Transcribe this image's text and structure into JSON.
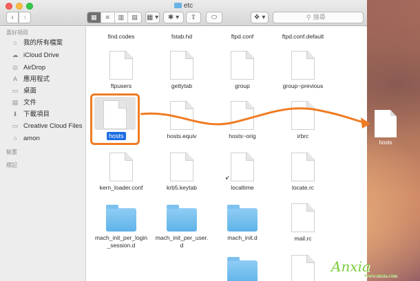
{
  "window": {
    "title": "etc"
  },
  "toolbar": {
    "back": "‹",
    "forward": "›",
    "view_icons": [
      "▦",
      "≡",
      "▥",
      "▤"
    ],
    "arrange": "▦ ▾",
    "action": "✱ ▾",
    "share": "⇪",
    "tag": "⬭",
    "dropbox": "❖ ▾",
    "search_placeholder": "搜尋",
    "search_icon": "⚲"
  },
  "sidebar": {
    "favorites_header": "喜好項目",
    "items": [
      {
        "icon": "⌂",
        "label": "我的所有檔案"
      },
      {
        "icon": "☁",
        "label": "iCloud Drive"
      },
      {
        "icon": "◎",
        "label": "AirDrop"
      },
      {
        "icon": "A",
        "label": "應用程式"
      },
      {
        "icon": "▭",
        "label": "桌面"
      },
      {
        "icon": "▤",
        "label": "文件"
      },
      {
        "icon": "⬇",
        "label": "下載項目"
      },
      {
        "icon": "▭",
        "label": "Creative Cloud Files"
      },
      {
        "icon": "⌂",
        "label": "amon"
      }
    ],
    "devices_header": "裝置",
    "tags_header": "標記"
  },
  "files": [
    {
      "name": "find.codes",
      "kind": "doc-partial"
    },
    {
      "name": "fstab.hd",
      "kind": "doc-partial"
    },
    {
      "name": "ftpd.conf",
      "kind": "doc-partial"
    },
    {
      "name": "ftpd.conf.default",
      "kind": "doc-partial"
    },
    {
      "name": "ftpusers",
      "kind": "doc"
    },
    {
      "name": "gettytab",
      "kind": "doc"
    },
    {
      "name": "group",
      "kind": "doc"
    },
    {
      "name": "group~previous",
      "kind": "doc"
    },
    {
      "name": "hosts",
      "kind": "selected"
    },
    {
      "name": "hosts.equiv",
      "kind": "doc"
    },
    {
      "name": "hosts~orig",
      "kind": "doc"
    },
    {
      "name": "irbrc",
      "kind": "doc"
    },
    {
      "name": "kern_loader.conf",
      "kind": "doc"
    },
    {
      "name": "krb5.keytab",
      "kind": "doc"
    },
    {
      "name": "localtime",
      "kind": "doc"
    },
    {
      "name": "locate.rc",
      "kind": "doc"
    },
    {
      "name": "mach_init_per_login_session.d",
      "kind": "folder"
    },
    {
      "name": "mach_init_per_user.d",
      "kind": "folder"
    },
    {
      "name": "mach_init.d",
      "kind": "folder"
    },
    {
      "name": "mail.rc",
      "kind": "doc"
    }
  ],
  "files_row1": [
    "find.codes",
    "fstab.hd",
    "ftpd.conf",
    "ftpd.conf.default"
  ],
  "files_row2": [
    "ftpusers",
    "gettytab",
    "group",
    "group~previous"
  ],
  "files_row3": [
    "hosts",
    "hosts.equiv",
    "hosts~orig",
    "irbrc"
  ],
  "files_row4": [
    "kern_loader.conf",
    "krb5.keytab",
    "localtime",
    "locate.rc"
  ],
  "files_row5": [
    "mach_init_per_login\n_session.d",
    "mach_init_per_user.\nd",
    "mach_init.d",
    "mail.rc"
  ],
  "desktop_file": {
    "label": "hosts"
  },
  "accent_colors": {
    "highlight_box": "#f07b22",
    "selection": "#1c6ce3",
    "folder": "#6ab2e6"
  },
  "watermark": {
    "text": "Anxia",
    "sub": "www.anxia.com"
  }
}
